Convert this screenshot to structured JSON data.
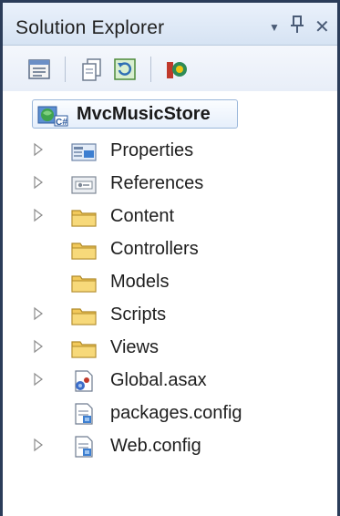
{
  "window": {
    "title": "Solution Explorer",
    "dropdown_glyph": "▼",
    "pin_glyph": "📌",
    "close_glyph": "✕"
  },
  "toolbar": {
    "buttons": [
      {
        "name": "properties-icon"
      },
      {
        "name": "show-all-files-icon"
      },
      {
        "name": "refresh-icon"
      },
      {
        "name": "class-diagram-icon"
      }
    ]
  },
  "tree": {
    "root": {
      "label": "MvcMusicStore",
      "icon": "csharp-web-project-icon"
    },
    "items": [
      {
        "label": "Properties",
        "icon": "properties-folder-icon",
        "expandable": true
      },
      {
        "label": "References",
        "icon": "references-folder-icon",
        "expandable": true
      },
      {
        "label": "Content",
        "icon": "folder-icon",
        "expandable": true
      },
      {
        "label": "Controllers",
        "icon": "folder-icon",
        "expandable": false
      },
      {
        "label": "Models",
        "icon": "folder-icon",
        "expandable": false
      },
      {
        "label": "Scripts",
        "icon": "folder-icon",
        "expandable": true
      },
      {
        "label": "Views",
        "icon": "folder-icon",
        "expandable": true
      },
      {
        "label": "Global.asax",
        "icon": "global-asax-file-icon",
        "expandable": true
      },
      {
        "label": "packages.config",
        "icon": "config-file-icon",
        "expandable": false
      },
      {
        "label": "Web.config",
        "icon": "config-file-icon",
        "expandable": true
      }
    ]
  },
  "colors": {
    "frame": "#2b3c59",
    "titlebar": "#d6e3f3",
    "folder": "#f2c95b",
    "text": "#1e1e1e"
  }
}
